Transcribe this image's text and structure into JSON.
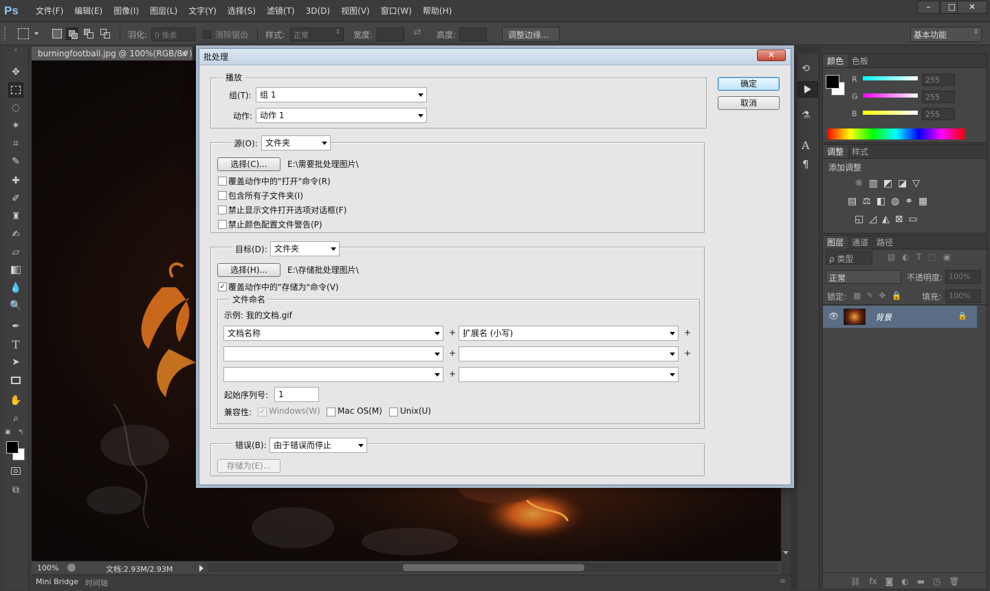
{
  "app": {
    "logo": "Ps"
  },
  "menu": [
    "文件(F)",
    "编辑(E)",
    "图像(I)",
    "图层(L)",
    "文字(Y)",
    "选择(S)",
    "滤镜(T)",
    "3D(D)",
    "视图(V)",
    "窗口(W)",
    "帮助(H)"
  ],
  "window_controls": {
    "minimize": "–",
    "maximize": "□",
    "close": "✕"
  },
  "options": {
    "feather_label": "羽化:",
    "feather_value": "0 像素",
    "antialias_label": "消除锯齿",
    "style_label": "样式:",
    "style_value": "正常",
    "width_label": "宽度:",
    "height_label": "高度:",
    "refine_button": "调整边缘...",
    "workspace": "基本功能"
  },
  "document": {
    "tab_title": "burningfootball.jpg @ 100%(RGB/8#)",
    "tab_close": "×",
    "zoom": "100%",
    "doc_info": "文档:2.93M/2.93M"
  },
  "bottom_tabs": [
    "Mini Bridge",
    "时间轴"
  ],
  "color_panel": {
    "tabs": [
      "颜色",
      "色板"
    ],
    "channels": [
      {
        "label": "R",
        "value": "255"
      },
      {
        "label": "G",
        "value": "255"
      },
      {
        "label": "B",
        "value": "255"
      }
    ]
  },
  "adjust_panel": {
    "tabs": [
      "调整",
      "样式"
    ],
    "title": "添加调整"
  },
  "layers_panel": {
    "tabs": [
      "图层",
      "通道",
      "路径"
    ],
    "filter_label": "ρ 类型",
    "blend_mode": "正常",
    "opacity_label": "不透明度:",
    "opacity_value": "100%",
    "lock_label": "锁定:",
    "fill_label": "填充:",
    "fill_value": "100%",
    "layer_name": "背景"
  },
  "dialog": {
    "title": "批处理",
    "close": "✕",
    "ok": "确定",
    "cancel": "取消",
    "play": {
      "legend": "播放",
      "set_label": "组(T):",
      "set_value": "组 1",
      "action_label": "动作:",
      "action_value": "动作 1"
    },
    "source": {
      "label": "源(O):",
      "value": "文件夹",
      "choose": "选择(C)...",
      "path": "E:\\需要批处理图片\\",
      "options": [
        {
          "label": "覆盖动作中的\"打开\"命令(R)",
          "checked": false
        },
        {
          "label": "包含所有子文件夹(I)",
          "checked": false
        },
        {
          "label": "禁止显示文件打开选项对话框(F)",
          "checked": false
        },
        {
          "label": "禁止颜色配置文件警告(P)",
          "checked": false
        }
      ]
    },
    "destination": {
      "label": "目标(D):",
      "value": "文件夹",
      "choose": "选择(H)...",
      "path": "E:\\存储批处理图片\\",
      "override_label": "覆盖动作中的\"存储为\"命令(V)",
      "override_checked": true,
      "naming": {
        "legend": "文件命名",
        "example": "示例: 我的文档.gif",
        "fields": [
          [
            "文档名称",
            "扩展名 (小写)"
          ],
          [
            "",
            ""
          ],
          [
            "",
            ""
          ]
        ],
        "plus": "+",
        "start_serial_label": "起始序列号:",
        "start_serial_value": "1",
        "compat_label": "兼容性:",
        "compat": [
          {
            "label": "Windows(W)",
            "checked": true,
            "disabled": true
          },
          {
            "label": "Mac OS(M)",
            "checked": false,
            "disabled": false
          },
          {
            "label": "Unix(U)",
            "checked": false,
            "disabled": false
          }
        ]
      }
    },
    "errors": {
      "label": "错误(B):",
      "value": "由于错误而停止",
      "save_as": "存储为(E)..."
    }
  }
}
